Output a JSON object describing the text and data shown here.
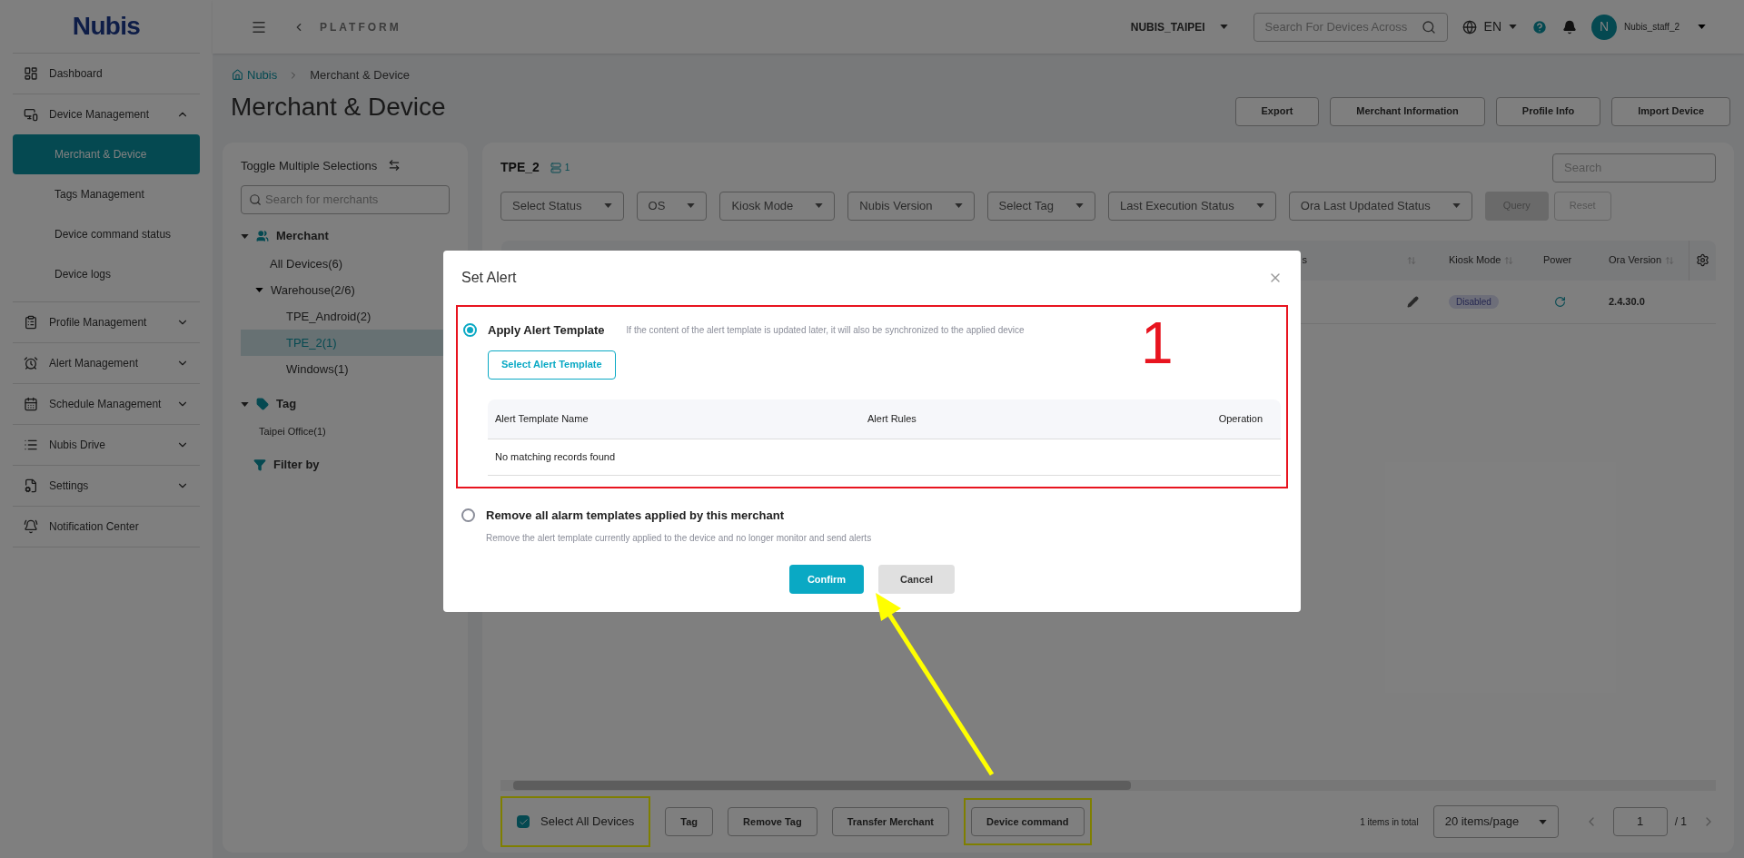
{
  "logo": {
    "text": "Nubis"
  },
  "sidebar": {
    "items": [
      {
        "label": "Dashboard",
        "kind": "link",
        "selected": false
      },
      {
        "label": "Device Management",
        "kind": "group",
        "expanded": true,
        "children": [
          {
            "label": "Merchant & Device",
            "selected": true
          },
          {
            "label": "Tags Management",
            "selected": false
          },
          {
            "label": "Device command status",
            "selected": false
          },
          {
            "label": "Device logs",
            "selected": false
          }
        ]
      },
      {
        "label": "Profile Management",
        "kind": "group",
        "expanded": false
      },
      {
        "label": "Alert Management",
        "kind": "group",
        "expanded": false
      },
      {
        "label": "Schedule Management",
        "kind": "group",
        "expanded": false
      },
      {
        "label": "Nubis Drive",
        "kind": "group",
        "expanded": false
      },
      {
        "label": "Settings",
        "kind": "group",
        "expanded": false
      },
      {
        "label": "Notification Center",
        "kind": "link",
        "selected": false
      }
    ]
  },
  "topbar": {
    "back_label": "PLATFORM",
    "organization": "NUBIS_TAIPEI",
    "search": {
      "placeholder": "Search For Devices Across"
    },
    "language": "EN",
    "user": {
      "initial": "N",
      "name": "Nubis_staff_2"
    }
  },
  "breadcrumb": [
    "Nubis",
    "Merchant & Device"
  ],
  "page_title": "Merchant & Device",
  "header_buttons": [
    "Export",
    "Merchant Information",
    "Profile Info",
    "Import Device"
  ],
  "merchant_panel": {
    "toggle_label": "Toggle Multiple Selections",
    "search": {
      "placeholder": "Search for merchants"
    },
    "tree": [
      {
        "label": "Merchant",
        "kind": "section",
        "expanded": true,
        "children": [
          {
            "label": "All Devices(6)",
            "kind": "node",
            "selected": false
          },
          {
            "label": "Warehouse(2/6)",
            "kind": "node",
            "selected": false,
            "expanded": true,
            "children": [
              {
                "label": "TPE_Android(2)",
                "kind": "node",
                "selected": false
              },
              {
                "label": "TPE_2(1)",
                "kind": "node",
                "selected": true
              },
              {
                "label": "Windows(1)",
                "kind": "node",
                "selected": false
              }
            ]
          }
        ]
      },
      {
        "label": "Tag",
        "kind": "section",
        "expanded": true,
        "children": [
          {
            "label": "Taipei Office(1)",
            "kind": "tag",
            "selected": false
          }
        ]
      },
      {
        "label": "Filter by",
        "kind": "filter"
      }
    ]
  },
  "device_panel": {
    "title": "TPE_2",
    "count": "1",
    "search": {
      "placeholder": "Search"
    },
    "filters": [
      "Select Status",
      "OS",
      "Kiosk Mode",
      "Nubis Version",
      "Select Tag",
      "Last Execution Status",
      "Ora Last Updated Status"
    ],
    "query_button": "Query",
    "reset_button": "Reset",
    "table": {
      "columns": [
        {
          "label": "s",
          "sortable": false
        },
        {
          "sortable": true
        },
        {
          "label": "Kiosk Mode",
          "sortable": true
        },
        {
          "label": "Power",
          "sortable": false
        },
        {
          "label": "Ora Version",
          "sortable": true
        }
      ],
      "rows": [
        {
          "kiosk_mode": "Disabled",
          "ora_version": "2.4.30.0"
        }
      ]
    },
    "select_all": {
      "label": "Select All Devices",
      "checked": true
    },
    "actions": [
      "Tag",
      "Remove Tag",
      "Transfer Merchant",
      "Device command"
    ],
    "total": "1 items in total",
    "page_size": "20 items/page",
    "page": "1",
    "page_total": "/ 1"
  },
  "modal": {
    "title": "Set Alert",
    "options": [
      {
        "label": "Apply Alert Template",
        "description": "If the content of the alert template is updated later, it will also be synchronized to the applied device",
        "selected": true,
        "template_button": "Select Alert Template",
        "table": {
          "columns": [
            "Alert Template Name",
            "Alert Rules",
            "Operation"
          ],
          "empty_text": "No matching records found"
        }
      },
      {
        "label": "Remove all alarm templates applied by this merchant",
        "description": "Remove the alert template currently applied to the device and no longer monitor and send alerts",
        "selected": false
      }
    ],
    "confirm": "Confirm",
    "cancel": "Cancel"
  },
  "annotation": {
    "marker": "1"
  }
}
